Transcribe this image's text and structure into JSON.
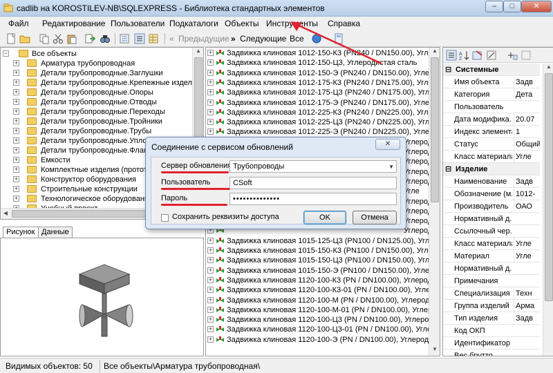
{
  "window": {
    "title": "cadlib на KOROSTILEV-NB\\SQLEXPRESS - Библиотека стандартных элементов",
    "min_label": "–",
    "max_label": "□",
    "close_label": "✕"
  },
  "menu": [
    "Файл",
    "Редактирование",
    "Пользователи",
    "Подкаталоги",
    "Объекты",
    "Инструменты",
    "Справка"
  ],
  "toolbar": {
    "prev_label": "Предыдущие",
    "next_label": "Следующие",
    "all_label": "Все"
  },
  "tree": {
    "root": "Все объекты",
    "items": [
      "Арматура трубопроводная",
      "Детали трубопроводные.Заглушки",
      "Детали трубопроводные.Крепежные изделия",
      "Детали трубопроводные.Опоры",
      "Детали трубопроводные.Отводы",
      "Детали трубопроводные.Переходы",
      "Детали трубопроводные.Тройники",
      "Детали трубопроводные.Трубы",
      "Детали трубопроводные.Уплотн",
      "Детали трубопроводные.Фланц",
      "Емкости",
      "Комплектные изделия (прототип",
      "Конструктор оборудования",
      "Строительные конструкции",
      "Технологическое оборудование",
      "Учебный проект"
    ]
  },
  "tabs": [
    "Рисунок",
    "Данные"
  ],
  "list": {
    "top": [
      "Задвижка клиновая 1012-150-К3 (PN240 / DN150.00), Углеродис",
      "Задвижка клиновая 1012-150-Ц3, Углеродистая сталь",
      "Задвижка клиновая 1012-150-Э (PN240 / DN150.00), Углеродист",
      "Задвижка клиновая 1012-175-К3 (PN240 / DN175.00), Углеродис",
      "Задвижка клиновая 1012-175-Ц3 (PN240 / DN175.00), Углеродис",
      "Задвижка клиновая 1012-175-Э (PN240 / DN175.00), Углеродист",
      "Задвижка клиновая 1012-225-К3 (PN240 / DN225.00), Углеродис",
      "Задвижка клиновая 1012-225-Ц3 (PN240 / DN225.00), Углеродис",
      "Задвижка клиновая 1012-225-Э (PN240 / DN225.00), Углеродист"
    ],
    "partial": [
      "Углерод",
      "Углерод",
      "Углерод",
      "Углерод",
      "Углерод",
      "Угле",
      "Углерод",
      "Углеродис",
      "Углеродист",
      "Углеродист"
    ],
    "bottom": [
      "Задвижка клиновая 1015-125-Ц3 (PN100 / DN125.00), Углеродис",
      "Задвижка клиновая 1015-150-К3 (PN100 / DN150.00), Углеродис",
      "Задвижка клиновая 1015-150-Ц3 (PN100 / DN150.00), Углеродис",
      "Задвижка клиновая 1015-150-Э (PN100 / DN150.00), Углеродист",
      "Задвижка клиновая 1120-100-К3 (PN / DN100.00), Углеродиста",
      "Задвижка клиновая 1120-100-К3-01 (PN / DN100.00), Углероди",
      "Задвижка клиновая 1120-100-М (PN / DN100.00), Углеродистая",
      "Задвижка клиновая 1120-100-М-01 (PN / DN100.00), Углеродис",
      "Задвижка клиновая 1120-100-Ц3 (PN / DN100.00), Углеродиста",
      "Задвижка клиновая 1120-100-Ц3-01 (PN / DN100.00), Углероди",
      "Задвижка клиновая 1120-100-Э (PN / DN100.00), Углеродиста"
    ]
  },
  "properties": {
    "cat1": "Системные",
    "sys": [
      {
        "name": "Имя объекта",
        "value": "Задв"
      },
      {
        "name": "Категория",
        "value": "Дета"
      },
      {
        "name": "Пользователь",
        "value": ""
      },
      {
        "name": "Дата модифика...",
        "value": "20.07"
      },
      {
        "name": "Индекс элемента",
        "value": "1"
      },
      {
        "name": "Статус",
        "value": "Общий"
      },
      {
        "name": "Класс материала",
        "value": "Угле"
      }
    ],
    "cat2": "Изделие",
    "item": [
      {
        "name": "Наименование",
        "value": "Задв"
      },
      {
        "name": "Обозначение (м...",
        "value": "1012-"
      },
      {
        "name": "Производитель",
        "value": "ОАО"
      },
      {
        "name": "Нормативный д...",
        "value": ""
      },
      {
        "name": "Ссылочный чер...",
        "value": ""
      },
      {
        "name": "Класс материала",
        "value": "Угле"
      },
      {
        "name": "Материал",
        "value": "Угле"
      },
      {
        "name": "Нормативный д...",
        "value": ""
      },
      {
        "name": "Примечания",
        "value": ""
      },
      {
        "name": "Специализация",
        "value": "Техн"
      },
      {
        "name": "Группа изделий",
        "value": "Арма"
      },
      {
        "name": "Тип изделия",
        "value": "Задв"
      },
      {
        "name": "Код ОКП",
        "value": ""
      },
      {
        "name": "Идентификатор",
        "value": ""
      },
      {
        "name": "Вес брутто",
        "value": ""
      }
    ]
  },
  "status": {
    "visible_count": "Видимых объектов: 50",
    "path": "Все объекты\\Арматура трубопроводная\\"
  },
  "dialog": {
    "title": "Соединение с сервисом обновлений",
    "close_label": "✕",
    "server_label": "Сервер обновления",
    "server_value": "Трубопроводы",
    "user_label": "Пользователь",
    "user_value": "CSoft",
    "password_label": "Пароль",
    "password_value": "••••••••••••••",
    "remember_label": "Сохранить реквизиты доступа",
    "ok_label": "OK",
    "cancel_label": "Отмена"
  },
  "colors": {
    "annotation": "#e0232f",
    "dialog_bg": "#dfe9f5"
  }
}
